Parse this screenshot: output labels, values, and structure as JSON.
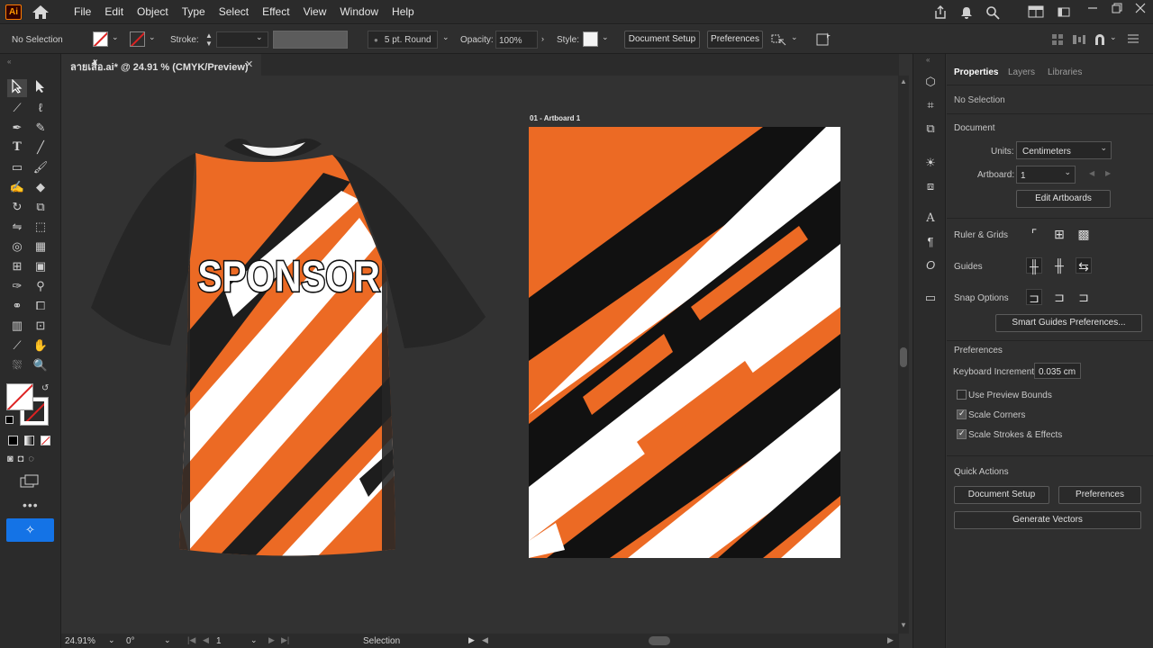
{
  "app": {
    "logo": "Ai",
    "title": "ลายเสื้อ.ai* @ 24.91 % (CMYK/Preview)"
  },
  "menu": [
    "File",
    "Edit",
    "Object",
    "Type",
    "Select",
    "Effect",
    "View",
    "Window",
    "Help"
  ],
  "control": {
    "selection": "No Selection",
    "stroke_label": "Stroke:",
    "brush": "5 pt. Round",
    "opacity_label": "Opacity:",
    "opacity_value": "100%",
    "style_label": "Style:",
    "document_setup": "Document Setup",
    "preferences": "Preferences"
  },
  "artboard": {
    "label": "01 - Artboard 1"
  },
  "shirt": {
    "sponsor_text": "SPONSOR"
  },
  "status": {
    "zoom": "24.91%",
    "rotation": "0°",
    "artboard_num": "1",
    "mode": "Selection"
  },
  "panel": {
    "tabs": [
      "Properties",
      "Layers",
      "Libraries"
    ],
    "no_selection": "No Selection",
    "document_heading": "Document",
    "units_label": "Units:",
    "units_value": "Centimeters",
    "artboard_label": "Artboard:",
    "artboard_value": "1",
    "edit_artboards": "Edit Artboards",
    "ruler_grids": "Ruler & Grids",
    "guides": "Guides",
    "snap_options": "Snap Options",
    "smart_guides_prefs": "Smart Guides Preferences...",
    "preferences_heading": "Preferences",
    "keyboard_increment_label": "Keyboard Increment:",
    "keyboard_increment_value": "0.035 cm",
    "use_preview_bounds": "Use Preview Bounds",
    "scale_corners": "Scale Corners",
    "scale_strokes": "Scale Strokes & Effects",
    "quick_actions": "Quick Actions",
    "qa_document_setup": "Document Setup",
    "qa_preferences": "Preferences",
    "generate_vectors": "Generate Vectors"
  },
  "colors": {
    "orange": "#ec6a24",
    "black": "#111111",
    "accent": "#1473e6"
  }
}
